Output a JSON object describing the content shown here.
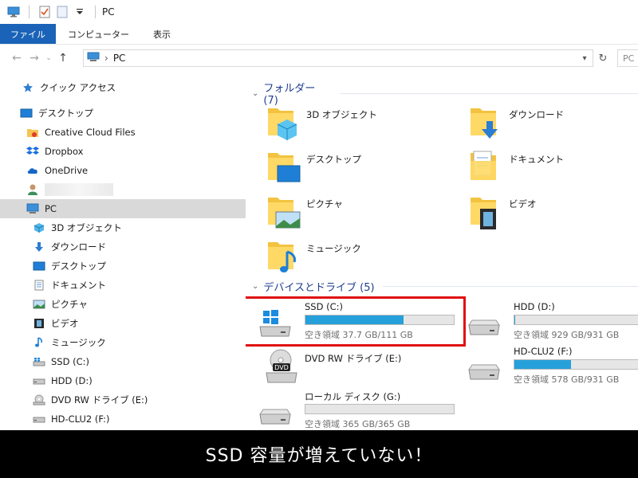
{
  "window": {
    "title": "PC"
  },
  "ribbon": {
    "tabs": [
      "ファイル",
      "コンピューター",
      "表示"
    ]
  },
  "address": {
    "crumb": "PC",
    "search_placeholder": "PC"
  },
  "nav": {
    "quick_access": "クイック アクセス",
    "desktop_root": "デスクトップ",
    "creative_cloud": "Creative Cloud Files",
    "dropbox": "Dropbox",
    "onedrive": "OneDrive",
    "pc": "PC",
    "objects3d": "3D オブジェクト",
    "downloads": "ダウンロード",
    "desktop": "デスクトップ",
    "documents": "ドキュメント",
    "pictures": "ピクチャ",
    "videos": "ビデオ",
    "music": "ミュージック",
    "ssd": "SSD (C:)",
    "hdd": "HDD (D:)",
    "dvd": "DVD RW ドライブ (E:)",
    "hdclu2": "HD-CLU2 (F:)"
  },
  "folders": {
    "header": "フォルダー (7)",
    "items": [
      "3D オブジェクト",
      "ダウンロード",
      "デスクトップ",
      "ドキュメント",
      "ピクチャ",
      "ビデオ",
      "ミュージック"
    ]
  },
  "drives": {
    "header": "デバイスとドライブ (5)",
    "ssd": {
      "name": "SSD (C:)",
      "free": "空き領域 37.7 GB/111 GB",
      "used_fraction": 0.66
    },
    "hdd": {
      "name": "HDD (D:)",
      "free": "空き領域 929 GB/931 GB",
      "used_fraction": 0.002
    },
    "dvd": {
      "name": "DVD RW ドライブ (E:)",
      "label": "DVD"
    },
    "hdclu2": {
      "name": "HD-CLU2 (F:)",
      "free": "空き領域 578 GB/931 GB",
      "used_fraction": 0.38
    },
    "local": {
      "name": "ローカル ディスク (G:)",
      "free": "空き領域 365 GB/365 GB",
      "used_fraction": 0.0
    }
  },
  "caption": "SSD 容量が増えていない！",
  "colors": {
    "accent": "#1a63b8",
    "bar_fill": "#26a0da",
    "highlight": "#e01010",
    "group_header": "#1e3d8f"
  }
}
